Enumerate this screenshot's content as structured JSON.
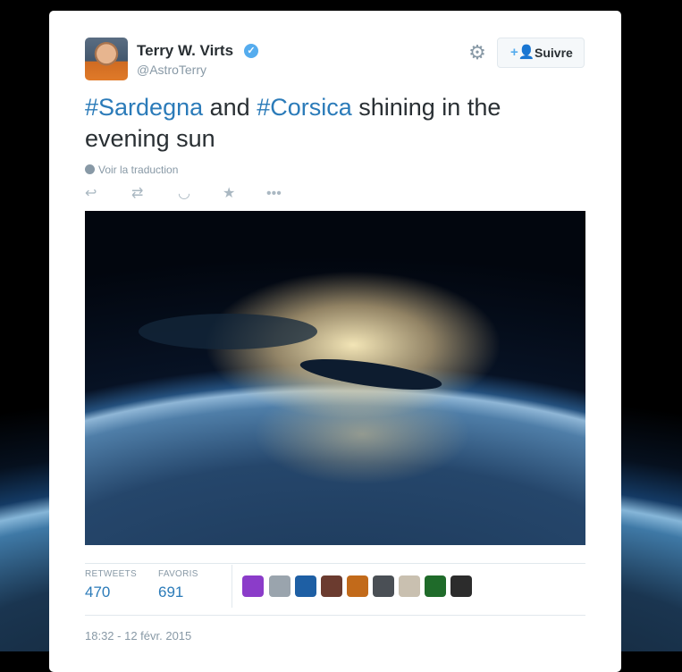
{
  "tweet": {
    "author_name": "Terry W. Virts",
    "handle": "@AstroTerry",
    "follow_label": "Suivre",
    "text_parts": [
      {
        "text": "#Sardegna",
        "type": "hashtag"
      },
      {
        "text": " and ",
        "type": "plain"
      },
      {
        "text": "#Corsica",
        "type": "hashtag"
      },
      {
        "text": " shining in the evening sun",
        "type": "plain"
      }
    ],
    "translate_label": "Voir la traduction",
    "retweets_label": "RETWEETS",
    "retweets_count": "470",
    "favorites_label": "FAVORIS",
    "favorites_count": "691",
    "timestamp": "18:32 - 12 févr. 2015"
  },
  "icons": {
    "verified": "verified-badge-icon",
    "settings": "gear-icon",
    "follow": "add-user-icon",
    "reply": "reply-icon",
    "retweet": "retweet-icon",
    "pocket": "pocket-icon",
    "favorite": "star-icon",
    "more": "more-dots-icon",
    "translate": "globe-icon"
  },
  "colors": {
    "link": "#2b7bb9",
    "follow_icon": "#55acee",
    "muted": "#8899a6"
  }
}
